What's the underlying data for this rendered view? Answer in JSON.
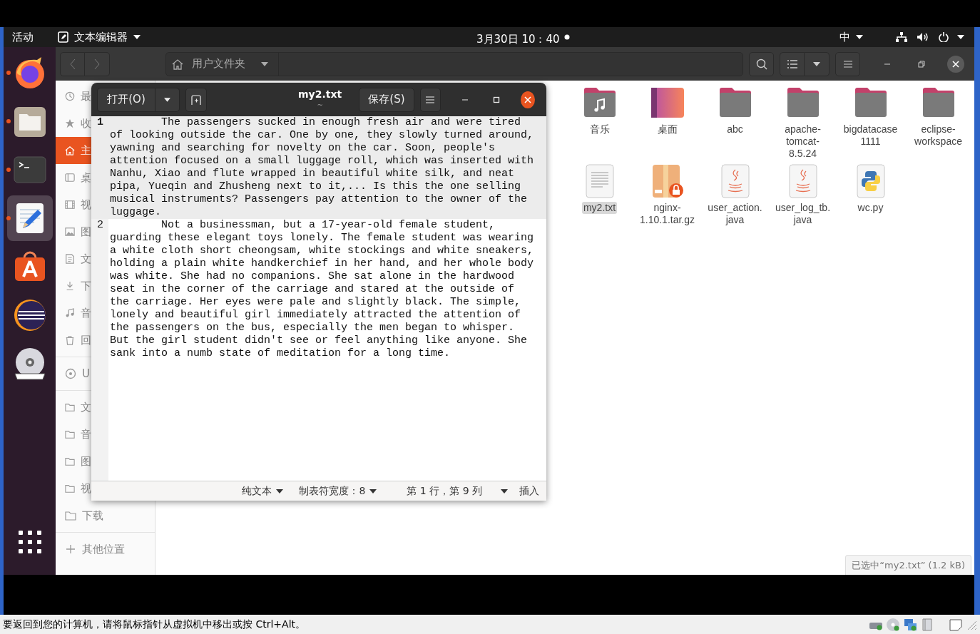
{
  "top_bar": {
    "activities": "活动",
    "app_menu": "文本编辑器",
    "clock": "3月30日 10：40",
    "input_method": "中"
  },
  "dock": {
    "items": [
      {
        "kind": "browser",
        "running": true,
        "active": false
      },
      {
        "kind": "files",
        "running": true,
        "active": false
      },
      {
        "kind": "terminal",
        "running": true,
        "active": false
      },
      {
        "kind": "text-editor",
        "running": true,
        "active": true
      },
      {
        "kind": "software",
        "running": false,
        "active": false
      },
      {
        "kind": "eclipse",
        "running": false,
        "active": false
      },
      {
        "kind": "dvd",
        "running": false,
        "active": false
      }
    ]
  },
  "files": {
    "path": "用户文件夹",
    "sidebar": [
      [
        {
          "label": "最",
          "kind": "recent",
          "selected": false
        },
        {
          "label": "收",
          "kind": "starred",
          "selected": false
        },
        {
          "label": "主",
          "kind": "home",
          "selected": true
        },
        {
          "label": "桌",
          "kind": "desktop",
          "selected": false
        },
        {
          "label": "视",
          "kind": "videos",
          "selected": false
        },
        {
          "label": "图",
          "kind": "pictures",
          "selected": false
        },
        {
          "label": "文",
          "kind": "documents",
          "selected": false
        },
        {
          "label": "下",
          "kind": "downloads",
          "selected": false
        },
        {
          "label": "音",
          "kind": "music",
          "selected": false
        },
        {
          "label": "回",
          "kind": "trash",
          "selected": false
        }
      ],
      [
        {
          "label": "U",
          "kind": "disc",
          "selected": false
        }
      ],
      [
        {
          "label": "文",
          "kind": "folder",
          "selected": false
        },
        {
          "label": "音",
          "kind": "folder",
          "selected": false
        },
        {
          "label": "图",
          "kind": "folder",
          "selected": false
        },
        {
          "label": "视",
          "kind": "folder",
          "selected": false
        },
        {
          "label": "下载",
          "kind": "folder",
          "selected": false
        }
      ],
      [
        {
          "label": "其他位置",
          "kind": "other",
          "selected": false
        }
      ]
    ],
    "items": [
      {
        "label": "音乐",
        "kind": "music-folder",
        "selected": false
      },
      {
        "label": "桌面",
        "kind": "desktop-folder",
        "selected": false
      },
      {
        "label": "abc",
        "kind": "folder",
        "selected": false
      },
      {
        "label": "apache-tomcat-8.5.24",
        "kind": "folder",
        "selected": false
      },
      {
        "label": "bigdatacase1111",
        "kind": "folder",
        "selected": false
      },
      {
        "label": "eclipse-workspace",
        "kind": "folder",
        "selected": false
      },
      {
        "label": "my2.txt",
        "kind": "text",
        "selected": true
      },
      {
        "label": "nginx-1.10.1.tar.gz",
        "kind": "archive",
        "selected": false
      },
      {
        "label": "user_action.java",
        "kind": "java",
        "selected": false
      },
      {
        "label": "user_log_tb.java",
        "kind": "java",
        "selected": false
      },
      {
        "label": "wc.py",
        "kind": "python",
        "selected": false
      }
    ],
    "status": "已选中“my2.txt” (1.2 kB)"
  },
  "editor": {
    "title": "my2.txt",
    "subtitle": "~",
    "open_button": "打开(O)",
    "save_button": "保存(S)",
    "lines": [
      {
        "number": "1",
        "current": true,
        "text": "\tThe passengers sucked in enough fresh air and were tired of looking outside the car. One by one, they slowly turned around, yawning and searching for novelty on the car. Soon, people's attention focused on a small luggage roll, which was inserted with Nanhu, Xiao and flute wrapped in beautiful white silk, and neat pipa, Yueqin and Zhusheng next to it,... Is this the one selling musical instruments? Passengers pay attention to the owner of the luggage."
      },
      {
        "number": "2",
        "current": false,
        "text": "\tNot a businessman, but a 17-year-old female student, guarding these elegant toys lonely. The female student was wearing a white cloth short cheongsam, white stockings and white sneakers, holding a plain white handkerchief in her hand, and her whole body was white. She had no companions. She sat alone in the hardwood seat in the corner of the carriage and stared at the outside of the carriage. Her eyes were pale and slightly black. The simple, lonely and beautiful girl immediately attracted the attention of the passengers on the bus, especially the men began to whisper. But the girl student didn't see or feel anything like anyone. She sank into a numb state of meditation for a long time."
      }
    ],
    "status": {
      "language": "纯文本",
      "tab_width": "制表符宽度：8",
      "position": "第 1 行，第 9 列",
      "mode": "插入"
    }
  },
  "vm_status": {
    "message": "要返回到您的计算机，请将鼠标指针从虚拟机中移出或按 Ctrl+Alt。"
  }
}
